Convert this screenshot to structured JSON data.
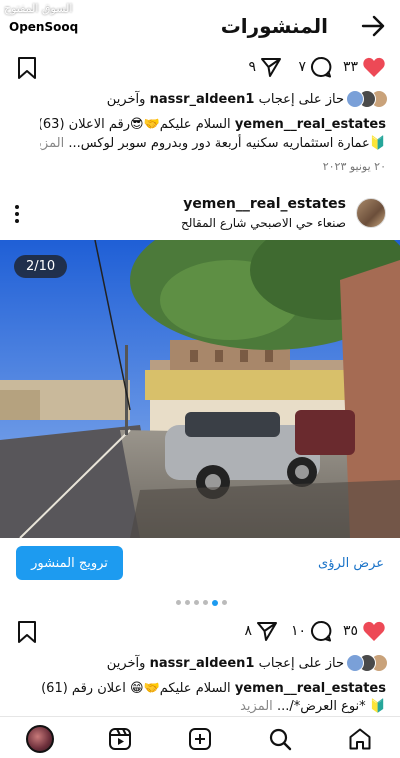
{
  "watermark": {
    "arabic": "السوق المفتوح",
    "brand": "OpenSooq"
  },
  "header": {
    "title": "المنشورات"
  },
  "post1": {
    "likes": "٣٣",
    "comments": "٧",
    "shares": "٩",
    "liked_by_prefix": "حاز على إعجاب",
    "liked_by_user": "nassr_aldeen1",
    "liked_by_suffix": "وآخرين",
    "caption_user": "yemen__real_estates",
    "caption_line1": "السلام عليكم🤝😎رقم الاعلان (63)",
    "caption_line2": "🔰عمارة استثماريه سكنيه أربعة دور وبدروم سوبر لوكس...",
    "more": "المزيد",
    "date": "٢٠ يونيو ٢٠٢٣"
  },
  "post2": {
    "user": "yemen__real_estates",
    "location": "صنعاء حي الاصبحي شارع المقالح",
    "image_counter": "2/10",
    "promote_label": "ترويج المنشور",
    "insights_label": "عرض الرؤى",
    "carousel_dots": 6,
    "active_dot": 4,
    "likes": "٣٥",
    "comments": "١٠",
    "shares": "٨",
    "liked_by_prefix": "حاز على إعجاب",
    "liked_by_user": "nassr_aldeen1",
    "liked_by_suffix": "وآخرين",
    "caption_user": "yemen__real_estates",
    "caption_line1": "السلام عليكم🤝😁 اعلان رقم (61)",
    "caption_line2": "🔰 *نوع العرض*/...",
    "more": "المزيد"
  },
  "colors": {
    "like": "#ed4956",
    "accent": "#1d9bf0",
    "link": "#1a73c8"
  },
  "bottom_nav": [
    "profile-icon",
    "reels-icon",
    "create-icon",
    "search-icon",
    "home-icon"
  ]
}
